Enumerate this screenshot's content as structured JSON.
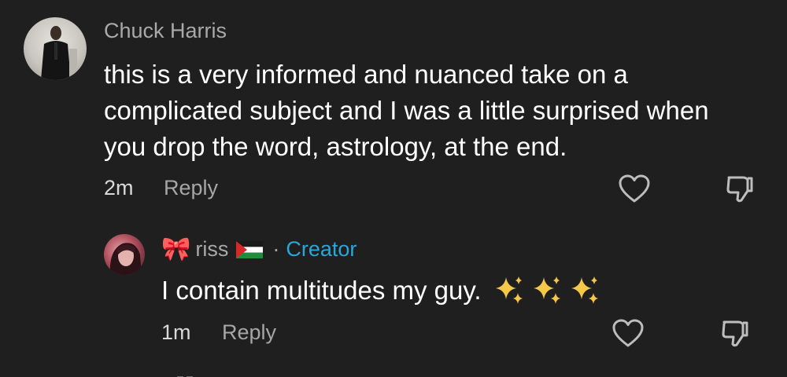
{
  "comment": {
    "username": "Chuck Harris",
    "text": "this is a very informed and nuanced take on a complicated subject and I was a little surprised when you drop the word, astrology, at the end.",
    "time": "2m",
    "reply_label": "Reply",
    "avatar_icon": "avatar-photo"
  },
  "reply": {
    "bow": "🎀",
    "username": "riss",
    "dot": "·",
    "badge": "Creator",
    "text": "I contain multitudes my guy.",
    "time": "1m",
    "reply_label": "Reply",
    "avatar_icon": "avatar-photo",
    "flag_icon": "palestine-flag-icon"
  },
  "colors": {
    "background": "#1f1f1f",
    "username": "#a9a9a9",
    "creator": "#2aa7d8",
    "text": "#ffffff",
    "sparkle": "#f5c84a"
  }
}
